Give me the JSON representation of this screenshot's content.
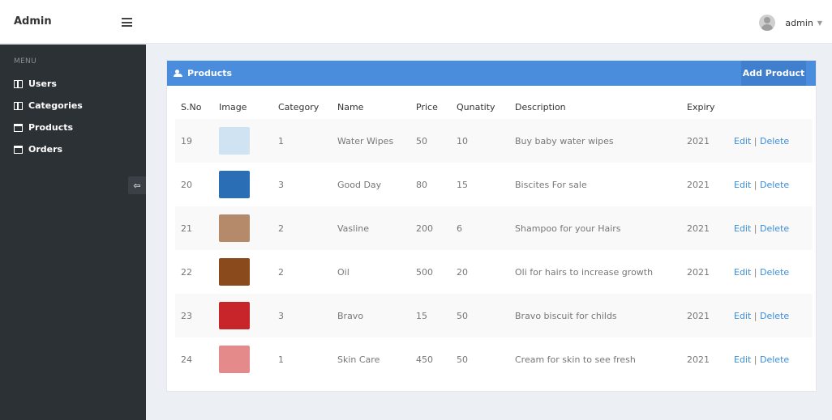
{
  "header": {
    "brand": "Admin",
    "user": "admin"
  },
  "sidebar": {
    "menu_title": "MENU",
    "items": [
      {
        "label": "Users",
        "icon": "book-icon"
      },
      {
        "label": "Categories",
        "icon": "book-icon"
      },
      {
        "label": "Products",
        "icon": "calendar-icon"
      },
      {
        "label": "Orders",
        "icon": "calendar-icon"
      }
    ]
  },
  "panel": {
    "title": "Products",
    "add_button": "Add Product",
    "columns": [
      "S.No",
      "Image",
      "Category",
      "Name",
      "Price",
      "Qunatity",
      "Description",
      "Expiry",
      ""
    ],
    "edit_label": "Edit",
    "delete_label": "Delete",
    "rows": [
      {
        "sno": "19",
        "category": "1",
        "name": "Water Wipes",
        "price": "50",
        "quantity": "10",
        "description": "Buy baby water wipes",
        "expiry": "2021",
        "thumb_color": "#cfe3f2"
      },
      {
        "sno": "20",
        "category": "3",
        "name": "Good Day",
        "price": "80",
        "quantity": "15",
        "description": "Biscites For sale",
        "expiry": "2021",
        "thumb_color": "#2a6fb5"
      },
      {
        "sno": "21",
        "category": "2",
        "name": "Vasline",
        "price": "200",
        "quantity": "6",
        "description": "Shampoo for your Hairs",
        "expiry": "2021",
        "thumb_color": "#b58a6a"
      },
      {
        "sno": "22",
        "category": "2",
        "name": "Oil",
        "price": "500",
        "quantity": "20",
        "description": "Oli for hairs to increase growth",
        "expiry": "2021",
        "thumb_color": "#8a4a1c"
      },
      {
        "sno": "23",
        "category": "3",
        "name": "Bravo",
        "price": "15",
        "quantity": "50",
        "description": "Bravo biscuit for childs",
        "expiry": "2021",
        "thumb_color": "#c8252b"
      },
      {
        "sno": "24",
        "category": "1",
        "name": "Skin Care",
        "price": "450",
        "quantity": "50",
        "description": "Cream for skin to see fresh",
        "expiry": "2021",
        "thumb_color": "#e58a8a"
      }
    ]
  }
}
